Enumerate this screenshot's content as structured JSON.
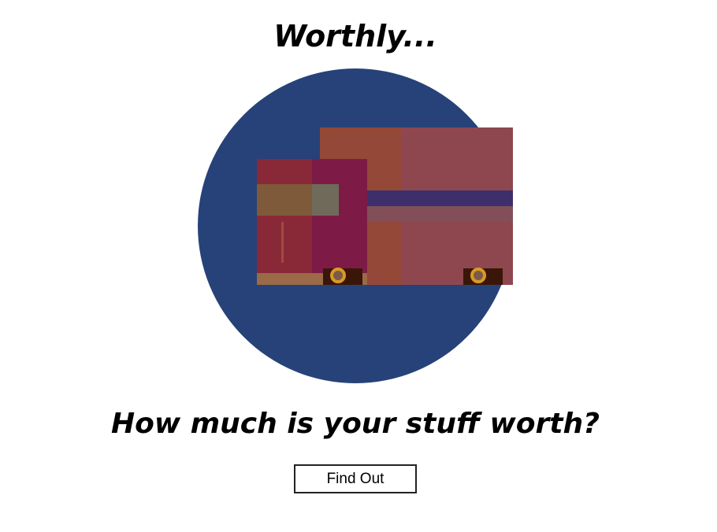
{
  "brand": {
    "title": "Worthly..."
  },
  "hero": {
    "illustration": "boxes-illustration",
    "circle_color": "#264278"
  },
  "main": {
    "headline": "How much is your stuff worth?"
  },
  "cta": {
    "label": "Find Out"
  }
}
